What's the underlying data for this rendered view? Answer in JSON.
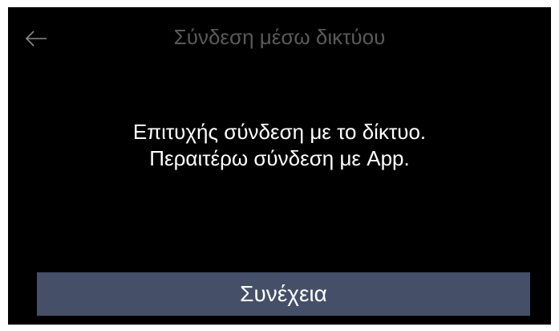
{
  "header": {
    "back_icon": "arrow-left-icon",
    "title": "Σύνδεση μέσω δικτύου"
  },
  "message": {
    "line1": "Επιτυχής σύνδεση με το δίκτυο.",
    "line2": "Περαιτέρω σύνδεση με App."
  },
  "footer": {
    "continue_label": "Συνέχεια"
  },
  "colors": {
    "background": "#000000",
    "title_text": "#5a5a5a",
    "button_bg": "#455068",
    "text": "#ffffff"
  }
}
